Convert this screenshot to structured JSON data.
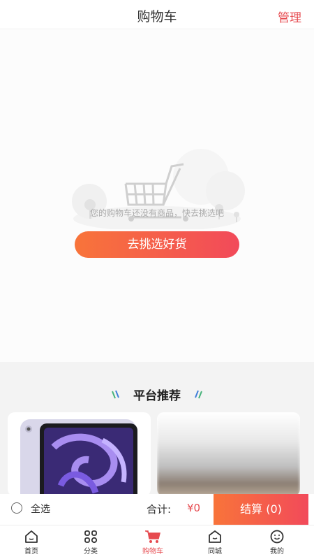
{
  "header": {
    "title": "购物车",
    "manage_label": "管理"
  },
  "empty_state": {
    "message": "您的购物车还没有商品，快去挑选吧",
    "button_label": "去挑选好货"
  },
  "recommend": {
    "title": "平台推荐"
  },
  "checkout": {
    "select_all_label": "全选",
    "total_label": "合计:",
    "total_amount": "¥0",
    "settle_label": "结算 (0)"
  },
  "tabs": [
    {
      "label": "首页",
      "icon": "home-icon"
    },
    {
      "label": "分类",
      "icon": "category-icon"
    },
    {
      "label": "购物车",
      "icon": "cart-icon"
    },
    {
      "label": "同城",
      "icon": "local-icon"
    },
    {
      "label": "我的",
      "icon": "profile-icon"
    }
  ],
  "colors": {
    "accent": "#e64a4f",
    "gradient_start": "#f8743a",
    "gradient_end": "#f24a5a"
  }
}
